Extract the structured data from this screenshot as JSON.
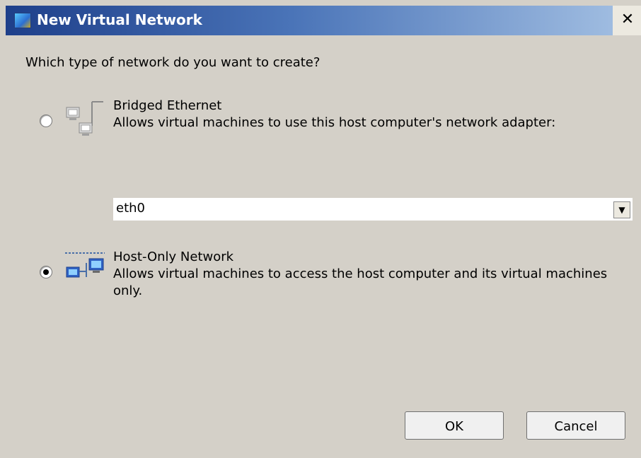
{
  "window": {
    "title": "New Virtual Network",
    "close_glyph": "✕",
    "icon": "virtual-network-app-icon"
  },
  "prompt": "Which type of network do you want to create?",
  "options": [
    {
      "label": "Bridged Ethernet",
      "description": "Allows virtual machines to use this host computer's network adapter:",
      "selected": false,
      "icon": "bridged-network-icon"
    },
    {
      "label": "Host-Only Network",
      "description_line1": "Allows virtual machines to access the host computer and its virtual machines",
      "description_line2": "only.",
      "selected": true,
      "icon": "host-only-network-icon"
    }
  ],
  "adapter_select": {
    "value": "eth0",
    "arrow_glyph": "▼"
  },
  "buttons": {
    "ok": "OK",
    "cancel": "Cancel"
  }
}
